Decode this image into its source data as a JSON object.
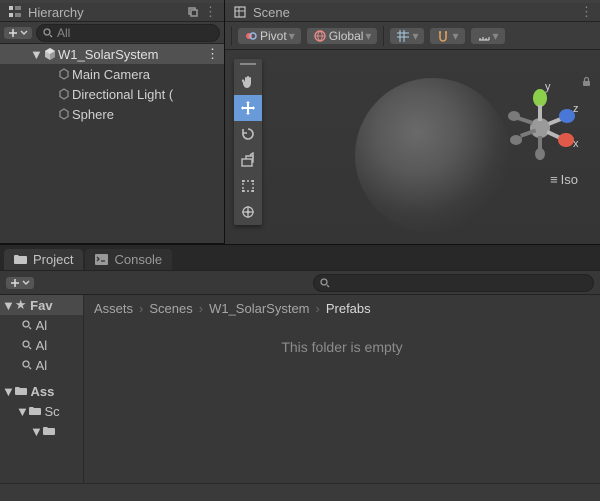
{
  "hierarchy": {
    "tab_title": "Hierarchy",
    "search_placeholder": "All",
    "root_scene": "W1_SolarSystem",
    "items": [
      {
        "label": "Main Camera"
      },
      {
        "label": "Directional Light ("
      },
      {
        "label": "Sphere"
      }
    ]
  },
  "scene": {
    "tab_title": "Scene",
    "pivot_label": "Pivot",
    "global_label": "Global",
    "axis_x": "x",
    "axis_y": "y",
    "axis_z": "z",
    "projection_label": "Iso",
    "tools": [
      "hand",
      "move",
      "rotate",
      "scale",
      "rect",
      "transform"
    ],
    "active_tool": "move"
  },
  "project": {
    "tabs": [
      {
        "label": "Project",
        "icon": "folder"
      },
      {
        "label": "Console",
        "icon": "console"
      }
    ],
    "sidebar": {
      "favorites_label": "Fav",
      "fav_items": [
        "Al",
        "Al",
        "Al"
      ],
      "assets_label": "Ass",
      "asset_items": [
        "Sc",
        ""
      ]
    },
    "breadcrumb": [
      "Assets",
      "Scenes",
      "W1_SolarSystem",
      "Prefabs"
    ],
    "empty_message": "This folder is empty"
  }
}
